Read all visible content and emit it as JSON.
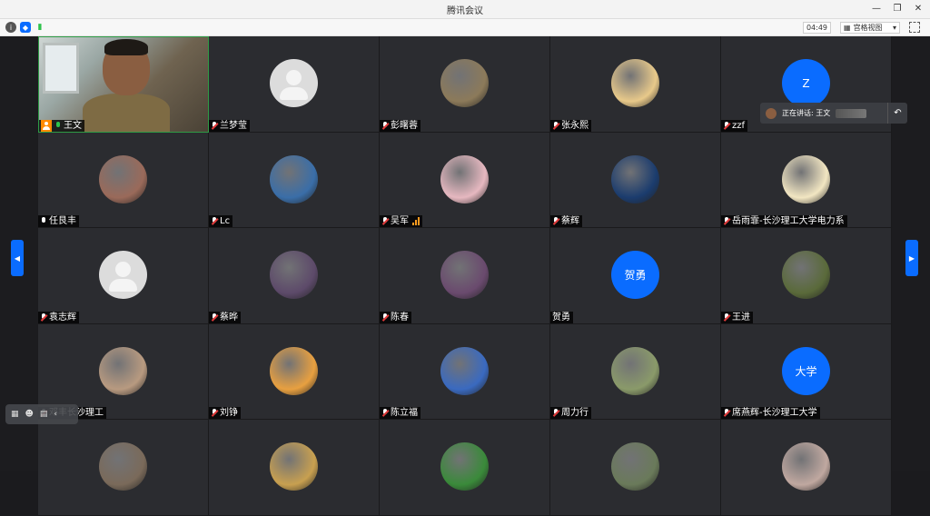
{
  "window": {
    "title": "腾讯会议"
  },
  "toolbar": {
    "timer": "04:49",
    "view_label": "宫格视图"
  },
  "speaking": {
    "label": "正在讲话: 王文"
  },
  "participants": [
    {
      "name": "王文",
      "type": "video"
    },
    {
      "name": "兰梦莹",
      "type": "default"
    },
    {
      "name": "彭曙蓉",
      "type": "photo",
      "color": "#8c7a5a"
    },
    {
      "name": "张永熙",
      "type": "photo",
      "color": "#e8c98a"
    },
    {
      "name": "zzf",
      "type": "letter",
      "letter": "Z"
    },
    {
      "name": "任艮丰",
      "type": "photo",
      "color": "#9a6a5a"
    },
    {
      "name": "Lc",
      "type": "photo",
      "color": "#3a6ea8"
    },
    {
      "name": "吴军",
      "type": "photo",
      "color": "#e6b8c0"
    },
    {
      "name": "蔡辉",
      "type": "photo",
      "color": "#1b3c6e"
    },
    {
      "name": "岳雨霏-长沙理工大学电力系",
      "type": "photo",
      "color": "#f2e6c2"
    },
    {
      "name": "袁志辉",
      "type": "default"
    },
    {
      "name": "蔡晔",
      "type": "photo",
      "color": "#5d4a6a"
    },
    {
      "name": "陈春",
      "type": "photo",
      "color": "#6a4a6e"
    },
    {
      "name": "贺勇",
      "type": "letter",
      "letter": "贺勇"
    },
    {
      "name": "王进",
      "type": "photo",
      "color": "#5a6a3a"
    },
    {
      "name": "邓丰长沙理工",
      "type": "photo",
      "color": "#b89a80"
    },
    {
      "name": "刘铮",
      "type": "photo",
      "color": "#e8a040"
    },
    {
      "name": "陈立福",
      "type": "photo",
      "color": "#3a6ac0"
    },
    {
      "name": "周力行",
      "type": "photo",
      "color": "#8a9a6a"
    },
    {
      "name": "席燕辉-长沙理工大学",
      "type": "letter",
      "letter": "大学"
    },
    {
      "name": "",
      "type": "photo",
      "color": "#7a6a5a"
    },
    {
      "name": "",
      "type": "photo",
      "color": "#c8a050"
    },
    {
      "name": "",
      "type": "photo",
      "color": "#3a8a3a"
    },
    {
      "name": "",
      "type": "photo",
      "color": "#6a7a5a"
    },
    {
      "name": "",
      "type": "photo",
      "color": "#c0a8a0"
    }
  ]
}
